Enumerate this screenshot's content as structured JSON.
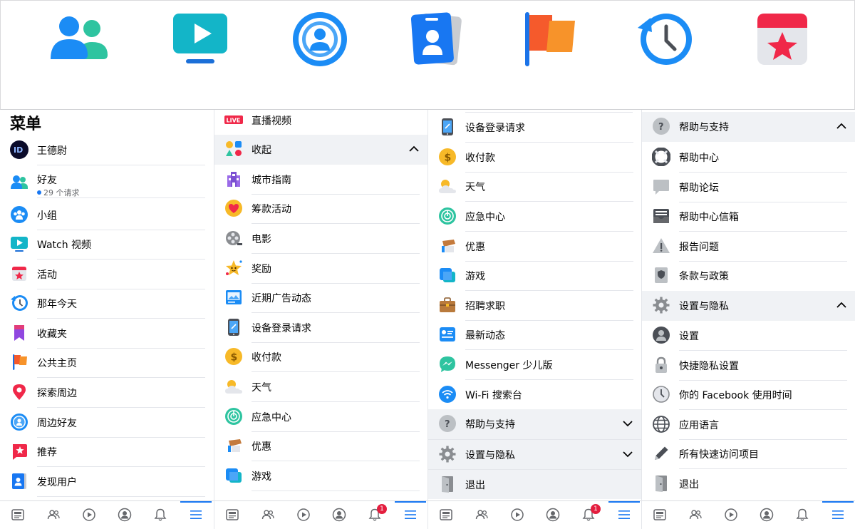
{
  "banner": {
    "icons": [
      "friends-icon",
      "watch-icon",
      "nearby-friends-icon",
      "discover-people-icon",
      "pages-icon",
      "memories-icon",
      "events-icon"
    ]
  },
  "panel1": {
    "title": "菜单",
    "rows": [
      {
        "label": "王德尉",
        "icon": "avatar"
      },
      {
        "label": "好友",
        "sub": "29 个请求",
        "icon": "friends-icon"
      },
      {
        "label": "小组",
        "icon": "groups-icon"
      },
      {
        "label": "Watch 视频",
        "icon": "watch-icon"
      },
      {
        "label": "活动",
        "icon": "events-icon"
      },
      {
        "label": "那年今天",
        "icon": "memories-icon"
      },
      {
        "label": "收藏夹",
        "icon": "saved-icon"
      },
      {
        "label": "公共主页",
        "icon": "pages-icon"
      },
      {
        "label": "探索周边",
        "icon": "nearby-icon"
      },
      {
        "label": "周边好友",
        "icon": "nearby-friends-icon"
      },
      {
        "label": "推荐",
        "icon": "recommend-icon"
      },
      {
        "label": "发现用户",
        "icon": "discover-people-icon"
      }
    ]
  },
  "panel2": {
    "rows": [
      {
        "label": "直播视频",
        "icon": "live-icon"
      },
      {
        "label": "收起",
        "icon": "shapes-icon"
      },
      {
        "label": "城市指南",
        "icon": "city-icon"
      },
      {
        "label": "筹款活动",
        "icon": "fundraiser-icon"
      },
      {
        "label": "电影",
        "icon": "movie-icon"
      },
      {
        "label": "奖励",
        "icon": "reward-icon"
      },
      {
        "label": "近期广告动态",
        "icon": "ads-icon"
      },
      {
        "label": "设备登录请求",
        "icon": "device-icon"
      },
      {
        "label": "收付款",
        "icon": "payment-icon"
      },
      {
        "label": "天气",
        "icon": "weather-icon"
      },
      {
        "label": "应急中心",
        "icon": "crisis-icon"
      },
      {
        "label": "优惠",
        "icon": "offers-icon"
      },
      {
        "label": "游戏",
        "icon": "games-icon"
      }
    ]
  },
  "panel3": {
    "rows": [
      {
        "label": "设备登录请求",
        "icon": "device-icon"
      },
      {
        "label": "收付款",
        "icon": "payment-icon"
      },
      {
        "label": "天气",
        "icon": "weather-icon"
      },
      {
        "label": "应急中心",
        "icon": "crisis-icon"
      },
      {
        "label": "优惠",
        "icon": "offers-icon"
      },
      {
        "label": "游戏",
        "icon": "games-icon"
      },
      {
        "label": "招聘求职",
        "icon": "jobs-icon"
      },
      {
        "label": "最新动态",
        "icon": "feed-icon"
      },
      {
        "label": "Messenger 少儿版",
        "icon": "messenger-icon"
      },
      {
        "label": "Wi-Fi 搜索台",
        "icon": "wifi-icon"
      },
      {
        "label": "帮助与支持",
        "icon": "help-icon"
      },
      {
        "label": "设置与隐私",
        "icon": "settings-icon"
      },
      {
        "label": "退出",
        "icon": "logout-icon"
      }
    ]
  },
  "panel4": {
    "rows": [
      {
        "label": "帮助与支持",
        "icon": "help-icon"
      },
      {
        "label": "帮助中心",
        "icon": "lifebuoy-icon"
      },
      {
        "label": "帮助论坛",
        "icon": "forum-icon"
      },
      {
        "label": "帮助中心信箱",
        "icon": "inbox-icon"
      },
      {
        "label": "报告问题",
        "icon": "warning-icon"
      },
      {
        "label": "条款与政策",
        "icon": "policy-icon"
      },
      {
        "label": "设置与隐私",
        "icon": "settings-icon"
      },
      {
        "label": "设置",
        "icon": "user-settings-icon"
      },
      {
        "label": "快捷隐私设置",
        "icon": "lock-icon"
      },
      {
        "label": "你的 Facebook 使用时间",
        "icon": "clock-icon"
      },
      {
        "label": "应用语言",
        "icon": "globe-icon"
      },
      {
        "label": "所有快速访问项目",
        "icon": "pencil-icon"
      },
      {
        "label": "退出",
        "icon": "logout-icon"
      }
    ]
  },
  "tabbar": {
    "tabs": [
      "news-feed-icon",
      "friends-tab-icon",
      "watch-tab-icon",
      "profile-tab-icon",
      "notifications-icon",
      "menu-icon"
    ],
    "badge": "1"
  },
  "colors": {
    "accent": "#1877f2",
    "badge": "#e41e3f",
    "grey_row": "#f0f2f5"
  }
}
